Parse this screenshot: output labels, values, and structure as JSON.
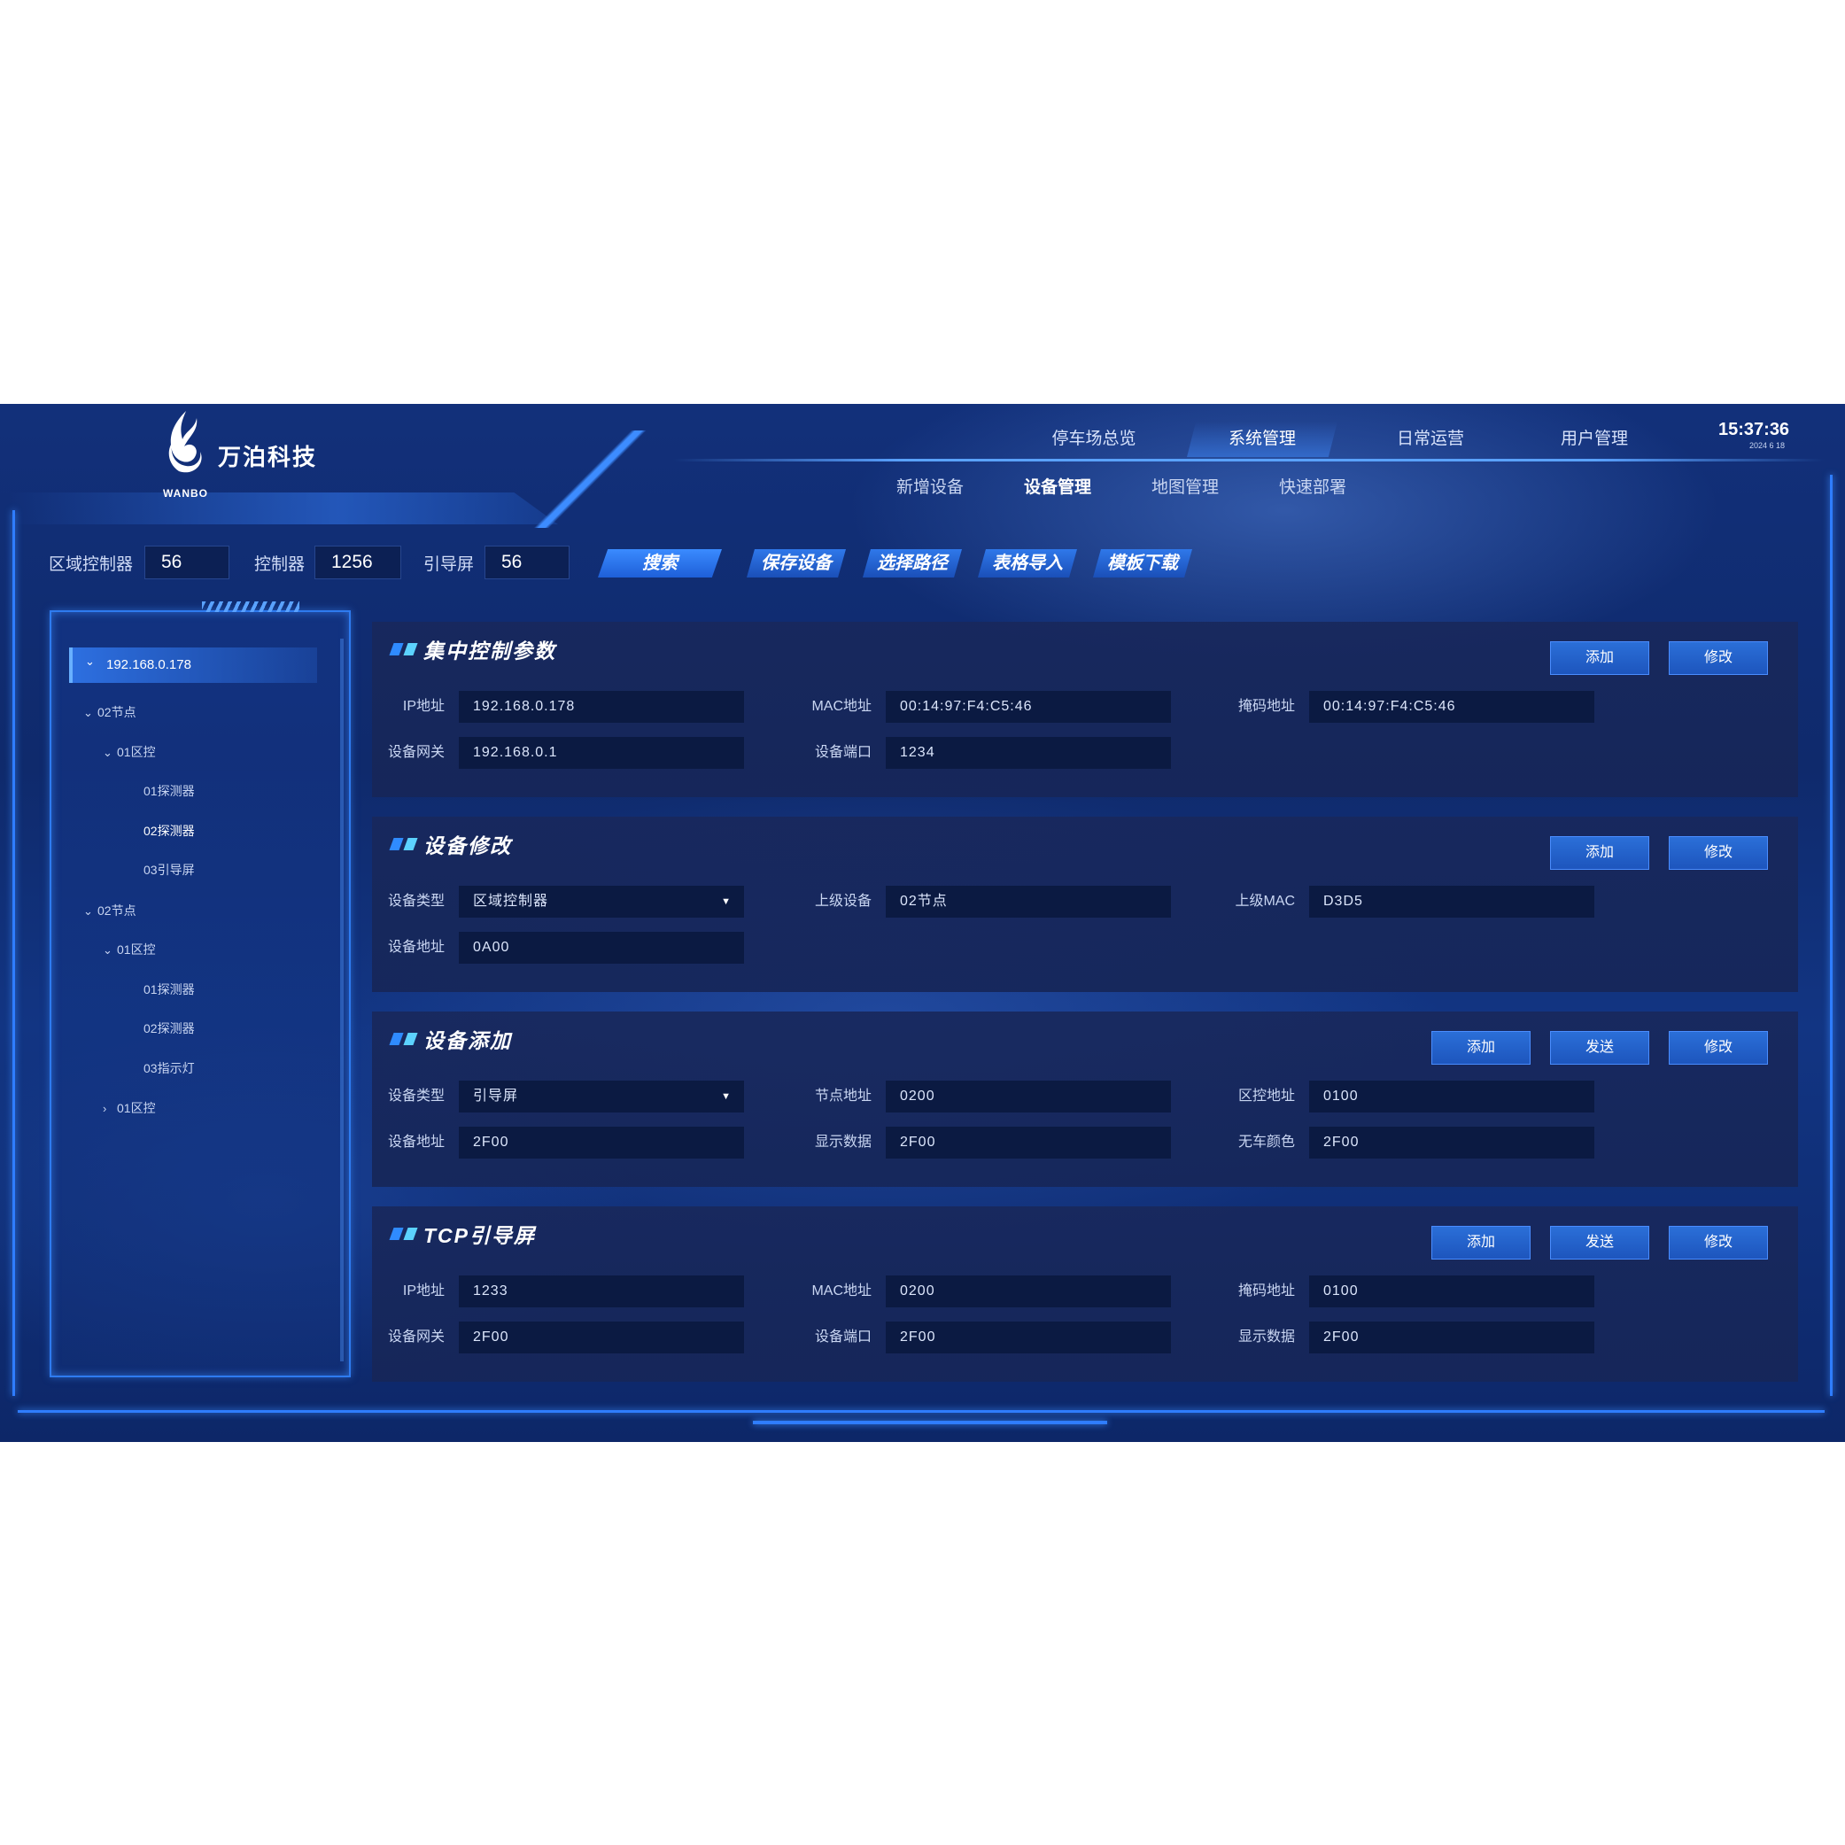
{
  "brand": {
    "name": "万泊科技",
    "sub": "WANBO"
  },
  "nav": {
    "top": [
      "停车场总览",
      "系统管理",
      "日常运营",
      "用户管理"
    ],
    "active_top": "系统管理",
    "sub": [
      "新增设备",
      "设备管理",
      "地图管理",
      "快速部署"
    ],
    "active_sub": "设备管理"
  },
  "clock": {
    "time": "15:37:36",
    "date": "2024 6 18"
  },
  "search": {
    "area_label": "区域控制器",
    "area_value": "56",
    "ctrl_label": "控制器",
    "ctrl_value": "1256",
    "guide_label": "引导屏",
    "guide_value": "56",
    "search_btn": "搜索",
    "actions": [
      "保存设备",
      "选择路径",
      "表格导入",
      "模板下载"
    ]
  },
  "tree": {
    "root": "192.168.0.178",
    "items": [
      {
        "label": "02节点",
        "chev": "⌄"
      },
      {
        "label": "01区控",
        "chev": "⌄"
      },
      {
        "label": "01探测器",
        "chev": ""
      },
      {
        "label": "02探测器",
        "chev": ""
      },
      {
        "label": "03引导屏",
        "chev": ""
      },
      {
        "label": "02节点",
        "chev": "⌄"
      },
      {
        "label": "01区控",
        "chev": "⌄"
      },
      {
        "label": "01探测器",
        "chev": ""
      },
      {
        "label": "02探测器",
        "chev": ""
      },
      {
        "label": "03指示灯",
        "chev": ""
      },
      {
        "label": "01区控",
        "chev": "›"
      }
    ]
  },
  "panels": [
    {
      "title": "集中控制参数",
      "buttons": [
        "添加",
        "修改"
      ],
      "fields": [
        {
          "label": "IP地址",
          "value": "192.168.0.178"
        },
        {
          "label": "MAC地址",
          "value": "00:14:97:F4:C5:46"
        },
        {
          "label": "掩码地址",
          "value": "00:14:97:F4:C5:46"
        },
        {
          "label": "设备网关",
          "value": "192.168.0.1"
        },
        {
          "label": "设备端口",
          "value": "1234"
        }
      ]
    },
    {
      "title": "设备修改",
      "buttons": [
        "添加",
        "修改"
      ],
      "fields": [
        {
          "label": "设备类型",
          "value": "区域控制器",
          "select": true
        },
        {
          "label": "上级设备",
          "value": "02节点"
        },
        {
          "label": "上级MAC",
          "value": "D3D5"
        },
        {
          "label": "设备地址",
          "value": "0A00"
        }
      ]
    },
    {
      "title": "设备添加",
      "buttons": [
        "添加",
        "发送",
        "修改"
      ],
      "fields": [
        {
          "label": "设备类型",
          "value": "引导屏",
          "select": true
        },
        {
          "label": "节点地址",
          "value": "0200"
        },
        {
          "label": "区控地址",
          "value": "0100"
        },
        {
          "label": "设备地址",
          "value": "2F00"
        },
        {
          "label": "显示数据",
          "value": "2F00"
        },
        {
          "label": "无车颜色",
          "value": "2F00"
        }
      ]
    },
    {
      "title": "TCP引导屏",
      "buttons": [
        "添加",
        "发送",
        "修改"
      ],
      "fields": [
        {
          "label": "IP地址",
          "value": "1233"
        },
        {
          "label": "MAC地址",
          "value": "0200"
        },
        {
          "label": "掩码地址",
          "value": "0100"
        },
        {
          "label": "设备网关",
          "value": "2F00"
        },
        {
          "label": "设备端口",
          "value": "2F00"
        },
        {
          "label": "显示数据",
          "value": "2F00"
        }
      ]
    }
  ],
  "colors": {
    "accent": "#2f7dff",
    "panel": "#18285c",
    "input": "#0b1a42",
    "button": "#2b6fd8"
  }
}
